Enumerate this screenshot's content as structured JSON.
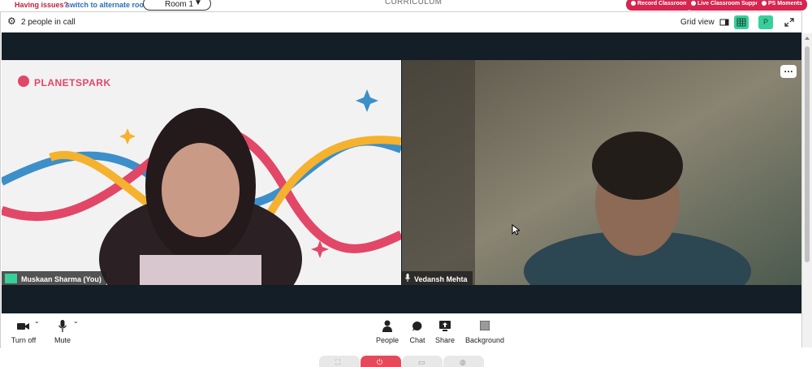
{
  "topbar": {
    "issues_text": "Having issues?",
    "alternate_link": "switch to alternate room",
    "room_label": "Room 1",
    "curriculum": "CURRICULUM",
    "pills": [
      "Record Classroom",
      "Live Classroom Support",
      "PS Moments"
    ]
  },
  "call": {
    "people_count": "2 people in call",
    "grid_view_label": "Grid view",
    "avatar_letter": "P"
  },
  "tiles": {
    "left": {
      "name": "Muskaan Sharma (You)",
      "brand": "PLANETSPARK"
    },
    "right": {
      "name": "Vedansh Mehta"
    }
  },
  "controls": {
    "turn_off": "Turn off",
    "mute": "Mute",
    "people": "People",
    "chat": "Chat",
    "share": "Share",
    "background": "Background"
  },
  "colors": {
    "accent_red": "#d6254f",
    "stage_bg": "#141e26",
    "grid_active": "#38d09a"
  }
}
